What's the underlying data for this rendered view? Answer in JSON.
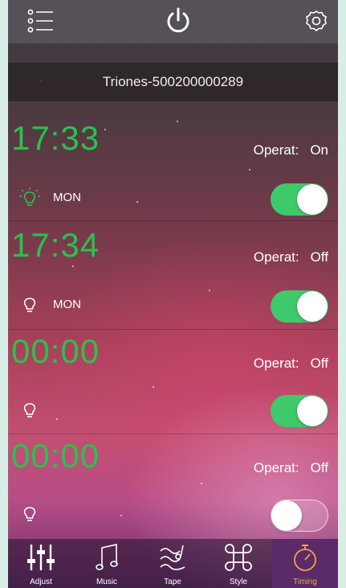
{
  "header": {
    "menu_icon": "list-menu-icon",
    "power_icon": "power-icon",
    "settings_icon": "gear-icon"
  },
  "device": {
    "name": "Triones-500200000289"
  },
  "timers": [
    {
      "time": "17:33",
      "operat_label": "Operat:",
      "operat_value": "On",
      "day": "MON",
      "enabled": true,
      "bulb_color": "#27c34c"
    },
    {
      "time": "17:34",
      "operat_label": "Operat:",
      "operat_value": "Off",
      "day": "MON",
      "enabled": true,
      "bulb_color": "#ffffff"
    },
    {
      "time": "00:00",
      "operat_label": "Operat:",
      "operat_value": "Off",
      "day": "",
      "enabled": true,
      "bulb_color": "#ffffff"
    },
    {
      "time": "00:00",
      "operat_label": "Operat:",
      "operat_value": "Off",
      "day": "",
      "enabled": false,
      "bulb_color": "#ffffff"
    }
  ],
  "nav": {
    "tabs": [
      {
        "label": "Adjust",
        "icon": "sliders-icon"
      },
      {
        "label": "Music",
        "icon": "music-note-icon"
      },
      {
        "label": "Tape",
        "icon": "microphone-waves-icon"
      },
      {
        "label": "Style",
        "icon": "command-icon"
      },
      {
        "label": "Timing",
        "icon": "stopwatch-icon",
        "active": true
      }
    ],
    "active_color": "#e8a64a"
  }
}
